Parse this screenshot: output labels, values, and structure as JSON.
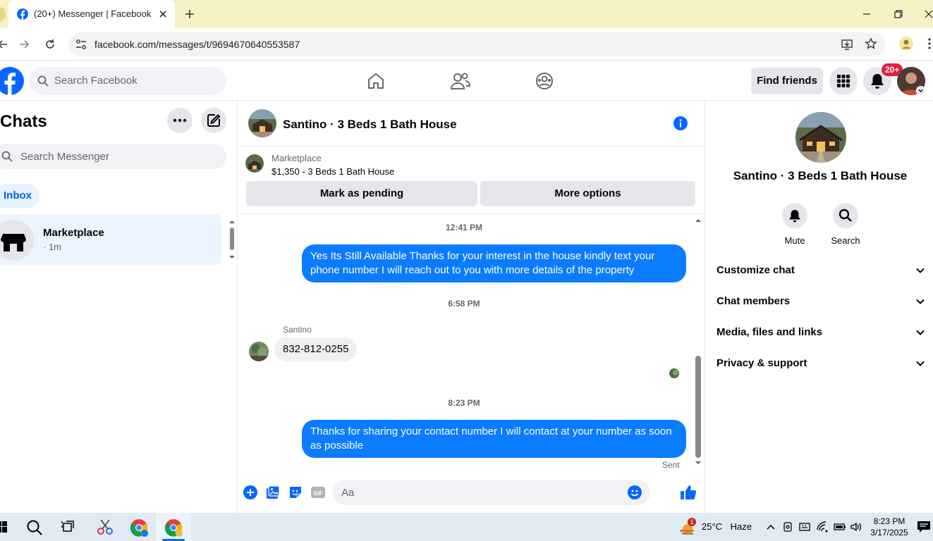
{
  "browser": {
    "tab_title": "(20+) Messenger | Facebook",
    "url": "facebook.com/messages/t/9694670640553587"
  },
  "fb_header": {
    "search_placeholder": "Search Facebook",
    "find_friends_label": "Find friends",
    "notification_badge": "20+"
  },
  "sidebar": {
    "title": "Chats",
    "search_placeholder": "Search Messenger",
    "filter_label": "Inbox",
    "chats": [
      {
        "name": "Marketplace",
        "time": "· 1m"
      }
    ]
  },
  "conversation": {
    "title": "Santino · 3 Beds 1 Bath House",
    "marketplace": {
      "label": "Marketplace",
      "listing": "$1,350 - 3 Beds 1 Bath House",
      "pending_button": "Mark as pending",
      "more_button": "More options"
    },
    "messages": [
      {
        "type": "timestamp",
        "text": "12:41 PM"
      },
      {
        "type": "outgoing",
        "text": "Yes Its Still Available Thanks for your interest in the house kindly text your phone number I will reach out to you with more details of the property"
      },
      {
        "type": "timestamp",
        "text": "6:58 PM"
      },
      {
        "type": "incoming",
        "sender": "Santino",
        "text": "832-812-0255"
      },
      {
        "type": "timestamp",
        "text": "8:23 PM"
      },
      {
        "type": "outgoing",
        "text": "Thanks for sharing your contact number I will contact at your number as soon as possible",
        "status": "Sent"
      }
    ],
    "composer_placeholder": "Aa"
  },
  "info_panel": {
    "name": "Santino · 3 Beds 1 Bath House",
    "actions": [
      {
        "label": "Mute"
      },
      {
        "label": "Search"
      }
    ],
    "sections": [
      {
        "label": "Customize chat"
      },
      {
        "label": "Chat members"
      },
      {
        "label": "Media, files and links"
      },
      {
        "label": "Privacy & support"
      }
    ]
  },
  "taskbar": {
    "weather_badge": "1",
    "temperature": "25°C",
    "condition": "Haze",
    "time": "8:23 PM",
    "date": "3/17/2025"
  },
  "colors": {
    "messenger_blue": "#0a7cff",
    "facebook_blue": "#0866ff",
    "chrome_tab_bar": "#f7f1c6",
    "badge_red": "#e41e3f"
  },
  "icons": {
    "browser": [
      "facebook-favicon",
      "close-icon",
      "plus-icon",
      "back-icon",
      "forward-icon",
      "reload-icon",
      "site-info-icon",
      "install-icon",
      "star-icon",
      "profile-icon",
      "kebab-icon"
    ],
    "composer": [
      "plus-circle-icon",
      "photo-icon",
      "sticker-icon",
      "gif-icon",
      "emoji-icon",
      "thumbs-up-icon"
    ]
  }
}
